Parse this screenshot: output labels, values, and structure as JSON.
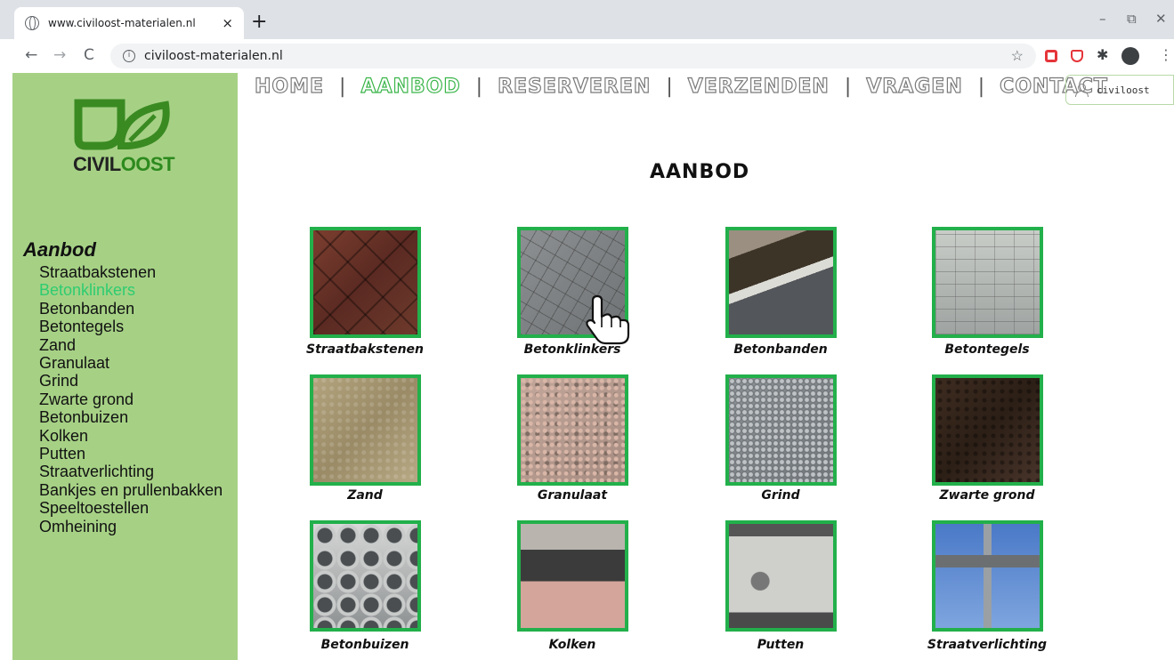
{
  "browser": {
    "tab_title": "www.civiloost-materialen.nl",
    "tab_close": "×",
    "new_tab": "+",
    "url": "civiloost-materialen.nl",
    "window_minimize": "–",
    "window_maximize": "⧉",
    "window_close": "✕",
    "back": "←",
    "forward": "→",
    "reload": "C",
    "bookmark": "☆",
    "menu": "⋮"
  },
  "logo": {
    "text_left": "CIVIL",
    "text_right": "OOST"
  },
  "sidebar": {
    "heading": "Aanbod",
    "items": [
      {
        "label": "Straatbakstenen",
        "active": false
      },
      {
        "label": "Betonklinkers",
        "active": true
      },
      {
        "label": "Betonbanden",
        "active": false
      },
      {
        "label": "Betontegels",
        "active": false
      },
      {
        "label": "Zand",
        "active": false
      },
      {
        "label": "Granulaat",
        "active": false
      },
      {
        "label": "Grind",
        "active": false
      },
      {
        "label": "Zwarte grond",
        "active": false
      },
      {
        "label": "Betonbuizen",
        "active": false
      },
      {
        "label": "Kolken",
        "active": false
      },
      {
        "label": "Putten",
        "active": false
      },
      {
        "label": "Straatverlichting",
        "active": false
      },
      {
        "label": "Bankjes en prullenbakken",
        "active": false
      },
      {
        "label": "Speeltoestellen",
        "active": false
      },
      {
        "label": "Omheining",
        "active": false
      }
    ]
  },
  "nav": {
    "separator": "|",
    "items": [
      {
        "label": "HOME",
        "active": false
      },
      {
        "label": "AANBOD",
        "active": true
      },
      {
        "label": "RESERVEREN",
        "active": false
      },
      {
        "label": "VERZENDEN",
        "active": false
      },
      {
        "label": "VRAGEN",
        "active": false
      },
      {
        "label": "CONTACT",
        "active": false
      }
    ]
  },
  "login": {
    "value": "civiloost"
  },
  "page_title": "AANBOD",
  "products": [
    {
      "label": "Straatbakstenen",
      "image": "t-brick"
    },
    {
      "label": "Betonklinkers",
      "image": "t-clinker"
    },
    {
      "label": "Betonbanden",
      "image": "t-banden"
    },
    {
      "label": "Betontegels",
      "image": "t-tegels"
    },
    {
      "label": "Zand",
      "image": "t-zand"
    },
    {
      "label": "Granulaat",
      "image": "t-granulaat"
    },
    {
      "label": "Grind",
      "image": "t-grind"
    },
    {
      "label": "Zwarte grond",
      "image": "t-grond"
    },
    {
      "label": "Betonbuizen",
      "image": "t-buizen"
    },
    {
      "label": "Kolken",
      "image": "t-kolken"
    },
    {
      "label": "Putten",
      "image": "t-putten"
    },
    {
      "label": "Straatverlichting",
      "image": "t-lamp"
    }
  ],
  "colors": {
    "sidebar_bg": "#a6d185",
    "accent_green": "#22b04b",
    "active_link": "#2ecc71"
  }
}
